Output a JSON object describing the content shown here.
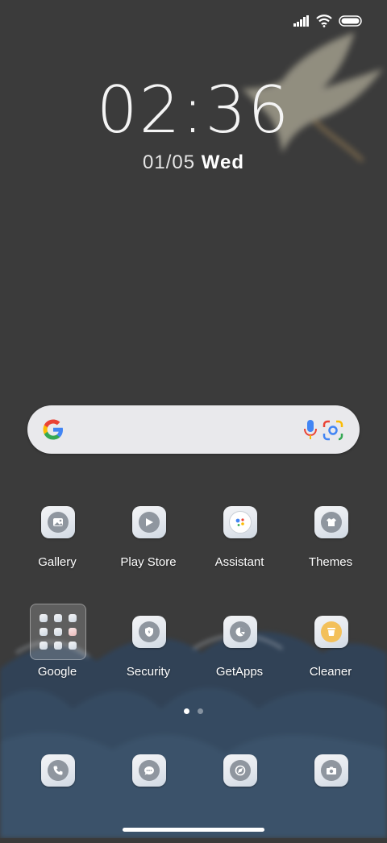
{
  "clock": {
    "time": "02:36",
    "date": "01/05",
    "day": "Wed"
  },
  "apps_row1": [
    {
      "label": "Gallery",
      "icon": "gallery-icon"
    },
    {
      "label": "Play Store",
      "icon": "play-store-icon"
    },
    {
      "label": "Assistant",
      "icon": "assistant-icon"
    },
    {
      "label": "Themes",
      "icon": "themes-icon"
    }
  ],
  "apps_row2": [
    {
      "label": "Google",
      "icon": "folder-icon"
    },
    {
      "label": "Security",
      "icon": "security-icon"
    },
    {
      "label": "GetApps",
      "icon": "getapps-icon"
    },
    {
      "label": "Cleaner",
      "icon": "cleaner-icon"
    }
  ],
  "dock": [
    {
      "icon": "phone-icon"
    },
    {
      "icon": "messages-icon"
    },
    {
      "icon": "browser-icon"
    },
    {
      "icon": "camera-icon"
    }
  ],
  "pages": {
    "total": 2,
    "current": 1
  },
  "colors": {
    "background": "#3a3a3a",
    "icon_glyph": "#8f969f"
  }
}
